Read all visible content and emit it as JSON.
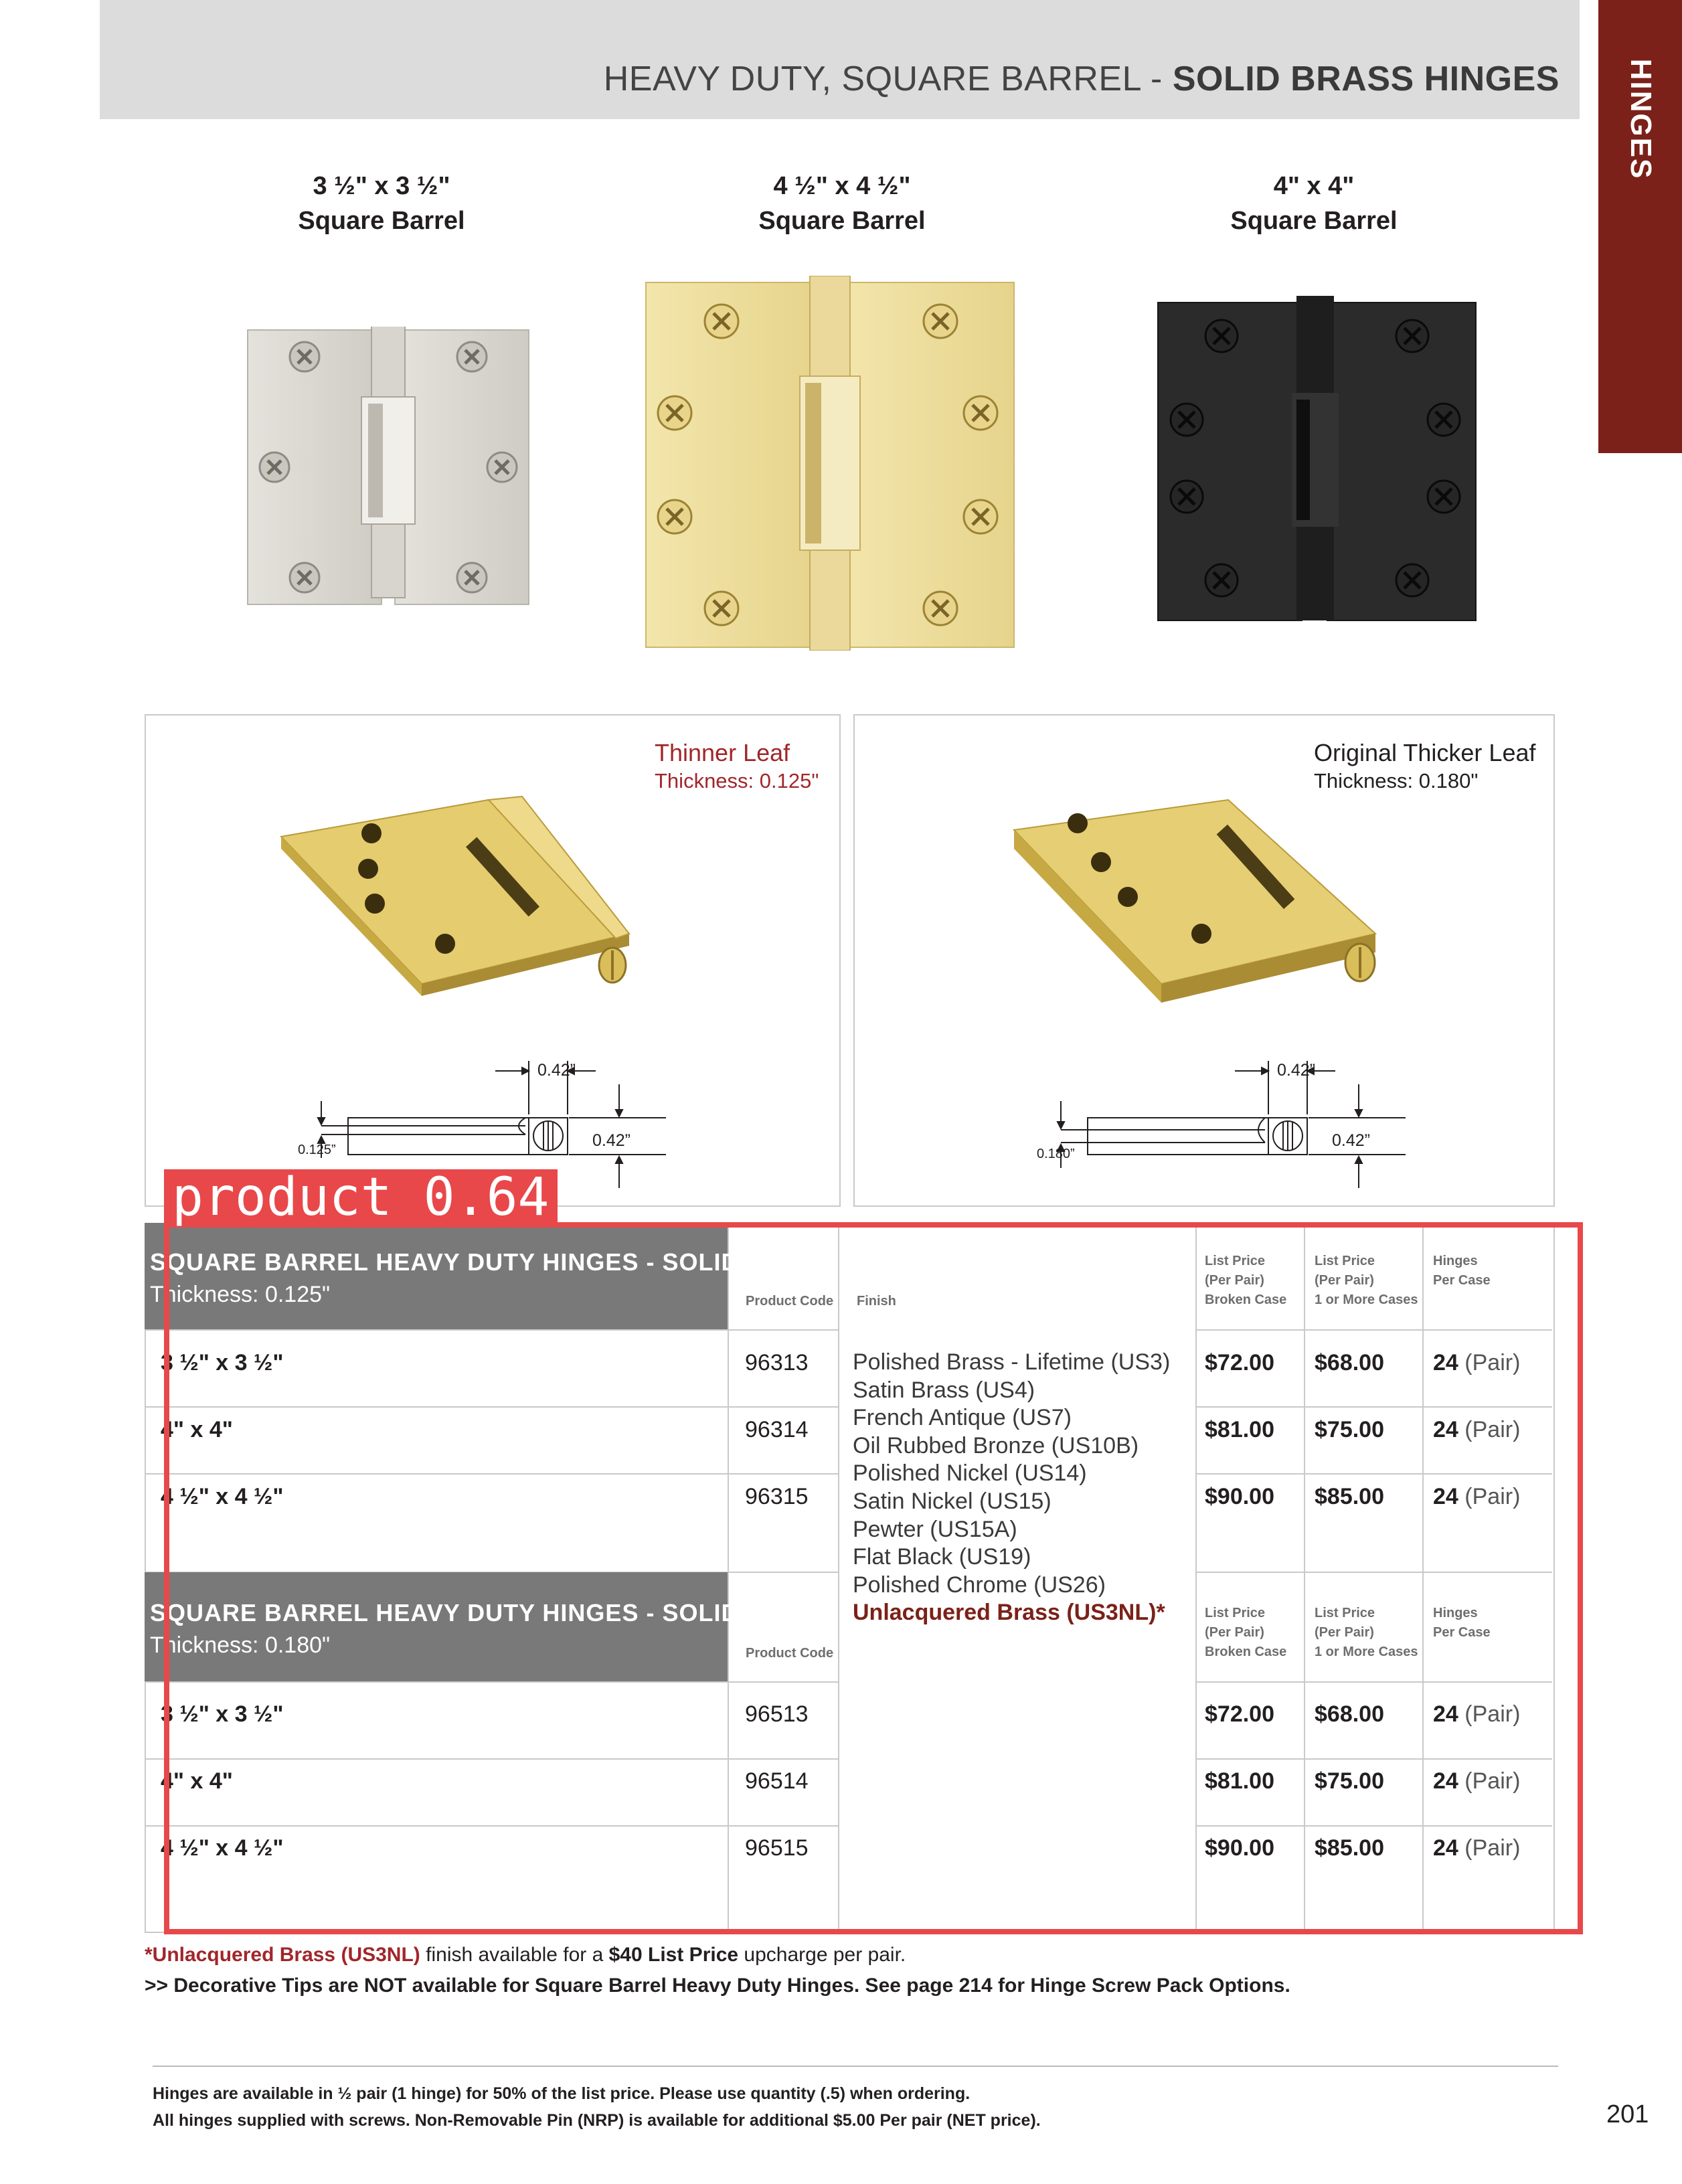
{
  "header": {
    "title_light": "HEAVY DUTY, SQUARE BARREL - ",
    "title_bold": "SOLID BRASS HINGES"
  },
  "side_tab": {
    "label": "HINGES"
  },
  "products": [
    {
      "size": "3 ½\" x 3 ½\"",
      "type": "Square Barrel",
      "finish_color": "#d8d6cf"
    },
    {
      "size": "4 ½\" x 4 ½\"",
      "type": "Square Barrel",
      "finish_color": "#eedd9e"
    },
    {
      "size": "4\" x 4\"",
      "type": "Square Barrel",
      "finish_color": "#232323"
    }
  ],
  "comparison": {
    "thin": {
      "title": "Thinner Leaf",
      "thickness": "Thickness: 0.125\"",
      "dim_width": "0.42”",
      "dim_height": "0.42”",
      "dim_leaf": "0.125”"
    },
    "thick": {
      "title": "Original Thicker Leaf",
      "thickness": "Thickness: 0.180\"",
      "dim_width": "0.42”",
      "dim_height": "0.42”",
      "dim_leaf": "0.180”"
    }
  },
  "detection": {
    "label": "product 0.64"
  },
  "table": {
    "columns": {
      "product_code": "Product Code",
      "finish": "Finish",
      "list_price_broken": [
        "List Price",
        "(Per Pair)",
        "Broken Case"
      ],
      "list_price_cases": [
        "List Price",
        "(Per Pair)",
        "1 or More Cases"
      ],
      "hinges_per_case": [
        "Hinges",
        "Per Case"
      ]
    },
    "section1": {
      "title": "SQUARE BARREL HEAVY DUTY HINGES - SOLID BRASS",
      "thickness": "Thickness: 0.125\"",
      "rows": [
        {
          "size": "3 ½\" x 3 ½\"",
          "code": "96313",
          "price_broken": "$72.00",
          "price_cases": "$68.00",
          "per_case": "24",
          "unit": "(Pair)"
        },
        {
          "size": "4\" x 4\"",
          "code": "96314",
          "price_broken": "$81.00",
          "price_cases": "$75.00",
          "per_case": "24",
          "unit": "(Pair)"
        },
        {
          "size": "4 ½\" x 4 ½\"",
          "code": "96315",
          "price_broken": "$90.00",
          "price_cases": "$85.00",
          "per_case": "24",
          "unit": "(Pair)"
        }
      ]
    },
    "section2": {
      "title": "SQUARE BARREL HEAVY DUTY HINGES - SOLID BRASS",
      "thickness": "Thickness: 0.180\"",
      "rows": [
        {
          "size": "3 ½\" x 3 ½\"",
          "code": "96513",
          "price_broken": "$72.00",
          "price_cases": "$68.00",
          "per_case": "24",
          "unit": "(Pair)"
        },
        {
          "size": "4\" x 4\"",
          "code": "96514",
          "price_broken": "$81.00",
          "price_cases": "$75.00",
          "per_case": "24",
          "unit": "(Pair)"
        },
        {
          "size": "4 ½\" x 4 ½\"",
          "code": "96515",
          "price_broken": "$90.00",
          "price_cases": "$85.00",
          "per_case": "24",
          "unit": "(Pair)"
        }
      ]
    },
    "finishes": [
      "Polished Brass - Lifetime (US3)",
      "Satin Brass (US4)",
      "French Antique (US7)",
      "Oil Rubbed Bronze (US10B)",
      "Polished Nickel (US14)",
      "Satin Nickel (US15)",
      "Pewter (US15A)",
      "Flat Black (US19)",
      "Polished Chrome (US26)"
    ],
    "finish_special": "Unlacquered Brass (US3NL)*"
  },
  "notes": {
    "line1_red": "*Unlacquered Brass (US3NL)",
    "line1_mid": " finish available for a ",
    "line1_bold": "$40 List Price",
    "line1_end": " upcharge per pair.",
    "line2": ">> Decorative Tips are NOT available for Square Barrel Heavy Duty Hinges. See page 214 for Hinge Screw Pack Options."
  },
  "footer": {
    "line1": "Hinges are available in ½ pair (1 hinge) for 50% of the list price. Please use quantity (.5) when ordering.",
    "line2": "All hinges supplied with screws. Non-Removable Pin (NRP) is available for additional $5.00 Per pair (NET price).",
    "page_number": "201"
  }
}
